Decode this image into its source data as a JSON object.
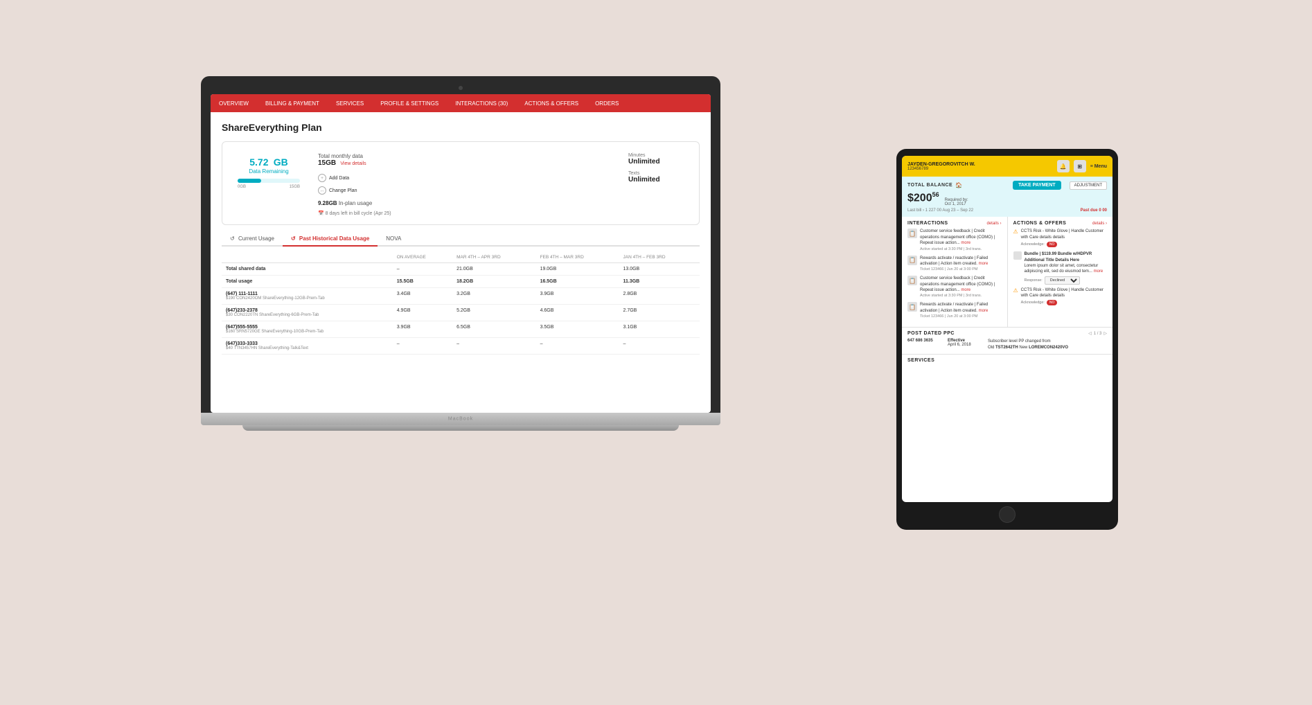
{
  "background_color": "#e8ddd8",
  "laptop": {
    "nav": {
      "items": [
        {
          "label": "OVERVIEW",
          "active": false
        },
        {
          "label": "BILLING & PAYMENT",
          "active": false
        },
        {
          "label": "SERVICES",
          "active": false
        },
        {
          "label": "PROFILE & SETTINGS",
          "active": false
        },
        {
          "label": "INTERACTIONS (30)",
          "active": false
        },
        {
          "label": "ACTIONS & OFFERS",
          "active": false
        },
        {
          "label": "ORDERS",
          "active": false
        }
      ]
    },
    "page_title": "ShareEverything Plan",
    "data_card": {
      "data_amount": "5.72",
      "data_unit": "GB",
      "data_label": "Data Remaining",
      "bar_pct": "38",
      "range_min": "0GB",
      "range_max": "15GB",
      "monthly_label": "Total monthly data",
      "monthly_amount": "15GB",
      "view_details": "View details",
      "actions": [
        {
          "label": "Add Data",
          "icon": "+"
        },
        {
          "label": "Change Plan",
          "icon": "↔"
        }
      ],
      "inplan_usage": "9.28GB",
      "inplan_label": "In-plan usage",
      "bill_cycle": "8 days left in bill cycle (Apr 25)",
      "minutes_label": "Minutes",
      "minutes_value": "Unlimited",
      "texts_label": "Texts",
      "texts_value": "Unlimited"
    },
    "tabs": [
      {
        "label": "Current Usage",
        "icon": "↺",
        "active": false
      },
      {
        "label": "Past Historical Data Usage",
        "icon": "↺",
        "active": true
      },
      {
        "label": "NOVA",
        "active": false
      }
    ],
    "table": {
      "headers": [
        "",
        "ON AVERAGE",
        "MAR 4TH – APR 3RD",
        "FEB 4TH – MAR 3RD",
        "JAN 4TH – FEB 3RD"
      ],
      "rows": [
        {
          "label": "Total shared data",
          "avg": "–",
          "mar": "21.0GB",
          "feb": "19.0GB",
          "jan": "13.0GB",
          "bold": true
        },
        {
          "label": "Total usage",
          "avg": "15.5GB",
          "mar": "18.2GB",
          "feb": "16.5GB",
          "jan": "11.3GB",
          "bold": true
        },
        {
          "phone": "(647) 111-1111",
          "plan": "$190 CON2420OM ShareEverything-12GB-Prem-Tab",
          "avg": "3.4GB",
          "mar": "3.2GB",
          "feb": "3.9GB",
          "jan": "2.8GB"
        },
        {
          "phone": "(647)233-2378",
          "plan": "$30 CON2220TN ShareEverything-6GB-Prem-Tab",
          "avg": "4.9GB",
          "mar": "5.2GB",
          "feb": "4.6GB",
          "jan": "2.7GB"
        },
        {
          "phone": "(647)555-5555",
          "plan": "$160 SRN5720GE ShareEverything-10GB-Prem-Tab",
          "avg": "3.9GB",
          "mar": "6.5GB",
          "feb": "3.5GB",
          "jan": "3.1GB"
        },
        {
          "phone": "(647)333-3333",
          "plan": "$40 TTN3457HN ShareEverything-Talk&Text",
          "avg": "–",
          "mar": "–",
          "feb": "–",
          "jan": "–"
        }
      ]
    }
  },
  "tablet": {
    "header": {
      "user_name": "JAYDEN-GREGOROVITCH W.",
      "account_id": "123456789",
      "icons": [
        "bell",
        "grid",
        "menu"
      ],
      "menu_label": "≡ Menu"
    },
    "balance": {
      "section_label": "TOTAL BALANCE",
      "amount": "200",
      "cents": "56",
      "required_by_label": "Required by:",
      "required_by_date": "Oct 1, 2017",
      "last_bill_label": "Last bill",
      "last_bill_amount": "› 1 227 00",
      "date_range": "Aug 23 – Sep 22",
      "past_due_label": "Past due 0 00",
      "take_payment_label": "TAKE PAYMENT",
      "adjustment_label": "ADJUSTMENT"
    },
    "interactions": {
      "section_title": "INTERACTIONS",
      "details_label": "details ›",
      "items": [
        {
          "text": "Customer service feedback | Credit operations management office (COMO) | Repeat issue action...",
          "more": "more",
          "active": "Active started at 3:30 PM | 3rd trans."
        },
        {
          "text": "Rewards activate / reactivate | Failed activation | Action item created.",
          "more": "more",
          "ticket": "Ticket 123466 | Jun 20 at 3:00 PM"
        },
        {
          "text": "Customer service feedback | Credit operations management office (COMO) | Repeat issue action...",
          "more": "more",
          "active": "Active started at 3:30 PM | 3rd trans."
        },
        {
          "text": "Rewards activate / reactivate | Failed activation | Action item created.",
          "more": "more",
          "ticket": "Ticket 123466 | Jun 20 at 3:00 PM"
        }
      ]
    },
    "actions_offers": {
      "section_title": "ACTIONS & OFFERS",
      "details_label": "details ›",
      "items": [
        {
          "text": "CCTS Risk - White Glove | Handle Customer with Care details details",
          "acknowledge": "NO"
        },
        {
          "text": "Bundle | $119.99 Bundle w/HDPVR Additional Title Details Here",
          "sub_text": "Lorem ipsum dolor sit amet, consectetur adipiscing elit, sed do eiusmod tem...",
          "more": "more",
          "response": "Declined"
        },
        {
          "text": "CCTS Risk - White Glove | Handle Customer with Care details details",
          "acknowledge": "NO"
        }
      ]
    },
    "post_dated": {
      "section_title": "Post Dated PPC",
      "nav": "1 / 3",
      "phone": "647 686 3635",
      "effective_label": "Effective",
      "effective_date": "April 6, 2018",
      "sub_label": "Subscriber level PP changed from",
      "old_label": "Old",
      "old_value": "TST2642TH",
      "new_label": "New",
      "new_value": "LOREMCON2420VO"
    },
    "services": {
      "section_title": "SERVICES"
    }
  }
}
